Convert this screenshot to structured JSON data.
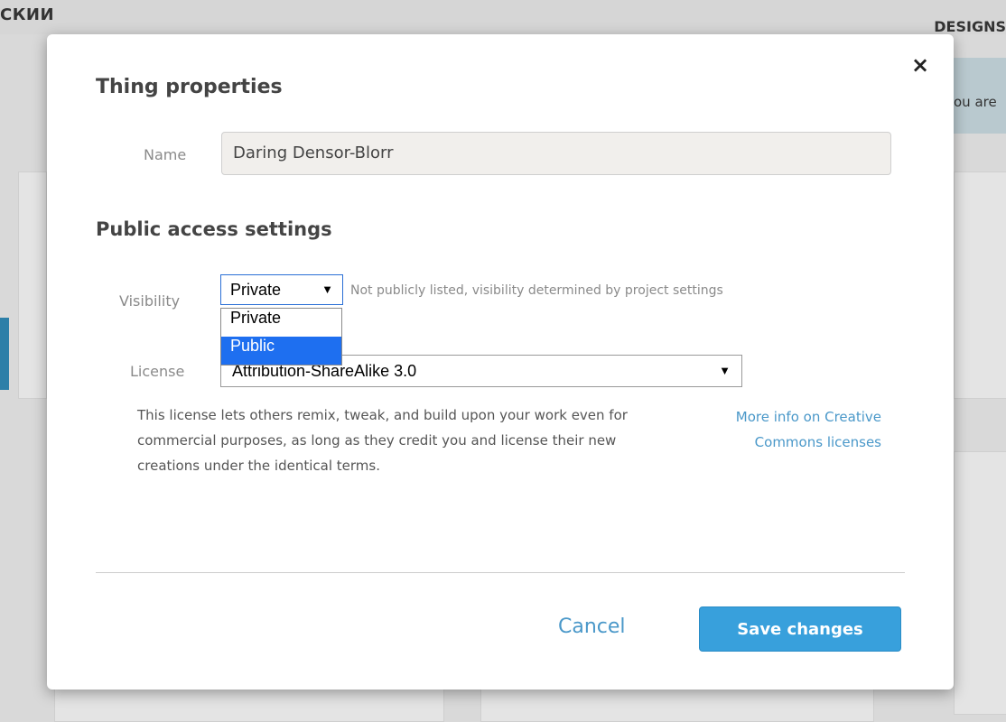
{
  "background": {
    "left_heading": "СКИИ",
    "right_heading": "DESIGNS",
    "banner_fragment": "ou are"
  },
  "dialog": {
    "title": "Thing properties",
    "close_label": "×",
    "name": {
      "label": "Name",
      "value": "Daring Densor-Blorr"
    },
    "section_title": "Public access settings",
    "visibility": {
      "label": "Visibility",
      "selected": "Private",
      "hint": "Not publicly listed, visibility determined by project settings",
      "options": [
        {
          "label": "Private",
          "highlighted": false
        },
        {
          "label": "Public",
          "highlighted": true
        }
      ]
    },
    "license": {
      "label": "License",
      "selected": "Attribution-ShareAlike 3.0",
      "description": "This license lets others remix, tweak, and build upon your work even for commercial purposes, as long as they credit you and license their new creations under the identical terms.",
      "more_info_line1": "More info on Creative",
      "more_info_line2": "Commons licenses"
    },
    "cancel_label": "Cancel",
    "save_label": "Save changes"
  },
  "colors": {
    "accent": "#38a0dc",
    "link": "#4a98c9",
    "dropdown_highlight": "#1e6ff0"
  },
  "icons": {
    "close": "close-icon",
    "dropdown_arrow": "caret-down-icon"
  }
}
